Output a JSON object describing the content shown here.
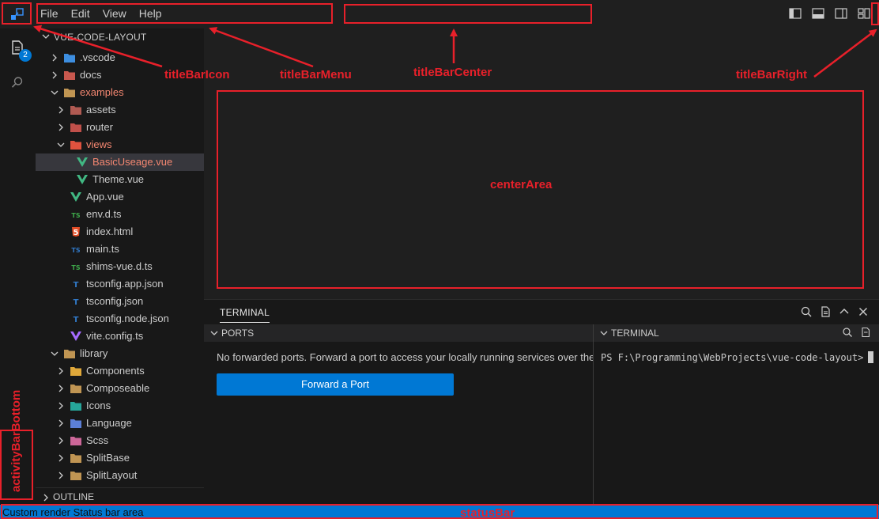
{
  "menu": [
    "File",
    "Edit",
    "View",
    "Help"
  ],
  "activity": {
    "badge": "2"
  },
  "explorer": {
    "title": "VUE-CODE-LAYOUT",
    "items": [
      {
        "label": ".vscode",
        "depth": 0,
        "type": "folder",
        "expanded": false,
        "icon": "vscode-folder-icon",
        "color": "#3d8ee0"
      },
      {
        "label": "docs",
        "depth": 0,
        "type": "folder",
        "expanded": false,
        "icon": "docs-folder-icon",
        "color": "#c8584e"
      },
      {
        "label": "examples",
        "depth": 0,
        "type": "folder",
        "expanded": true,
        "icon": "examples-folder-icon",
        "color": "#c09553",
        "highlight": true
      },
      {
        "label": "assets",
        "depth": 1,
        "type": "folder",
        "expanded": false,
        "icon": "assets-folder-icon",
        "color": "#b05a52"
      },
      {
        "label": "router",
        "depth": 1,
        "type": "folder",
        "expanded": false,
        "icon": "router-folder-icon",
        "color": "#c0504a"
      },
      {
        "label": "views",
        "depth": 1,
        "type": "folder",
        "expanded": true,
        "icon": "views-folder-icon",
        "color": "#e0523f",
        "highlight": true
      },
      {
        "label": "BasicUseage.vue",
        "depth": 2,
        "type": "vue",
        "icon": "vue-file-icon",
        "color": "#41b883",
        "highlight": true,
        "selected": true
      },
      {
        "label": "Theme.vue",
        "depth": 2,
        "type": "vue",
        "icon": "vue-file-icon",
        "color": "#41b883"
      },
      {
        "label": "App.vue",
        "depth": 1,
        "type": "vue",
        "icon": "vue-file-icon",
        "color": "#41b883"
      },
      {
        "label": "env.d.ts",
        "depth": 1,
        "type": "ts",
        "icon": "ts-file-icon",
        "color": "#3ea84a",
        "glyph": "TS"
      },
      {
        "label": "index.html",
        "depth": 1,
        "type": "html",
        "icon": "html-file-icon",
        "color": "#e44d26",
        "glyph": "5"
      },
      {
        "label": "main.ts",
        "depth": 1,
        "type": "ts",
        "icon": "ts-file-icon",
        "color": "#3178c6",
        "glyph": "TS"
      },
      {
        "label": "shims-vue.d.ts",
        "depth": 1,
        "type": "ts",
        "icon": "ts-file-icon",
        "color": "#3ea84a",
        "glyph": "TS"
      },
      {
        "label": "tsconfig.app.json",
        "depth": 1,
        "type": "tsconfig",
        "icon": "tsconfig-file-icon",
        "color": "#3178c6",
        "glyph": "T"
      },
      {
        "label": "tsconfig.json",
        "depth": 1,
        "type": "tsconfig",
        "icon": "tsconfig-file-icon",
        "color": "#3178c6",
        "glyph": "T"
      },
      {
        "label": "tsconfig.node.json",
        "depth": 1,
        "type": "tsconfig",
        "icon": "tsconfig-file-icon",
        "color": "#3178c6",
        "glyph": "T"
      },
      {
        "label": "vite.config.ts",
        "depth": 1,
        "type": "vite",
        "icon": "vite-file-icon",
        "color": "#a66bff"
      },
      {
        "label": "library",
        "depth": 0,
        "type": "folder",
        "expanded": true,
        "icon": "library-folder-icon",
        "color": "#c09553"
      },
      {
        "label": "Components",
        "depth": 1,
        "type": "folder",
        "expanded": false,
        "icon": "components-folder-icon",
        "color": "#e0a83a"
      },
      {
        "label": "Composeable",
        "depth": 1,
        "type": "folder",
        "expanded": false,
        "icon": "folder-icon",
        "color": "#c09553"
      },
      {
        "label": "Icons",
        "depth": 1,
        "type": "folder",
        "expanded": false,
        "icon": "icons-folder-icon",
        "color": "#26a69a"
      },
      {
        "label": "Language",
        "depth": 1,
        "type": "folder",
        "expanded": false,
        "icon": "language-folder-icon",
        "color": "#5c7fd6"
      },
      {
        "label": "Scss",
        "depth": 1,
        "type": "folder",
        "expanded": false,
        "icon": "scss-folder-icon",
        "color": "#cd6799"
      },
      {
        "label": "SplitBase",
        "depth": 1,
        "type": "folder",
        "expanded": false,
        "icon": "folder-icon",
        "color": "#c09553"
      },
      {
        "label": "SplitLayout",
        "depth": 1,
        "type": "folder",
        "expanded": false,
        "icon": "folder-icon",
        "color": "#c09553"
      }
    ],
    "outline_label": "OUTLINE"
  },
  "panel": {
    "tab": "TERMINAL",
    "ports_header": "PORTS",
    "ports_message": "No forwarded ports. Forward a port to access your locally running services over the",
    "forward_button": "Forward a Port",
    "terminal_header": "TERMINAL",
    "prompt": "PS F:\\Programming\\WebProjects\\vue-code-layout>"
  },
  "status_bar": {
    "text": "Custom render Status bar area"
  },
  "annotations": {
    "titleBarIcon": "titleBarIcon",
    "titleBarMenu": "titleBarMenu",
    "titleBarCenter": "titleBarCenter",
    "titleBarRight": "titleBarRight",
    "centerArea": "centerArea",
    "activityBarBottom": "activityBarBottom",
    "statusBar": "statusBar"
  },
  "colors": {
    "accent": "#0078d4",
    "annotation": "#e8202a",
    "highlight_text": "#f48771"
  }
}
